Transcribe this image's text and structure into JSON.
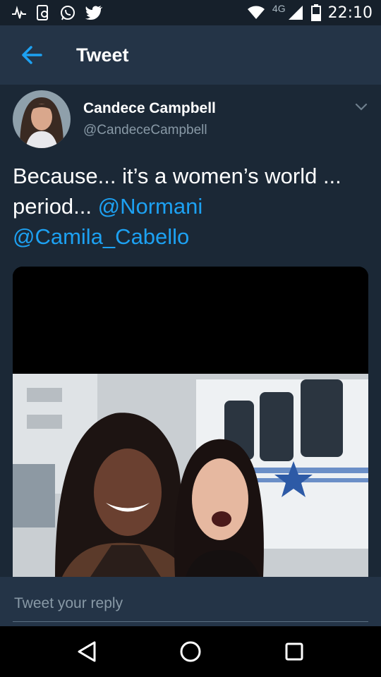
{
  "status_bar": {
    "time": "22:10",
    "network": "4G",
    "left_icons": [
      "pulse-icon",
      "phone-sync-icon",
      "whatsapp-icon",
      "twitter-bird-icon"
    ],
    "right_icons": [
      "wifi-icon",
      "cell-signal-icon",
      "battery-icon"
    ]
  },
  "app_bar": {
    "title": "Tweet",
    "accent_color": "#1da1f2"
  },
  "tweet": {
    "author_name": "Candece Campbell",
    "author_handle": "@CandeceCampbell",
    "text_plain": "Because... it’s a women’s world ... period...",
    "mention_1": "@Normani",
    "mention_2": "@Camila_Cabello",
    "media": "photo of two smiling women in front of a white trailer with a blue star"
  },
  "reply": {
    "placeholder": "Tweet your reply"
  },
  "nav_bar": {
    "buttons": [
      "back-triangle-icon",
      "home-circle-icon",
      "recents-square-icon"
    ]
  },
  "colors": {
    "background": "#1b2836",
    "app_bar": "#243447",
    "link": "#1da1f2",
    "secondary_text": "#8899a6"
  }
}
